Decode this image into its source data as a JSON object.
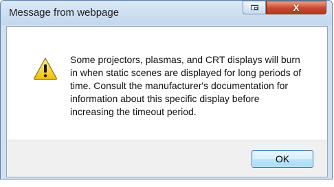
{
  "window": {
    "title": "Message from webpage",
    "controls": {
      "restore_icon": "restore-icon",
      "close_icon": "close-icon",
      "close_glyph": "X"
    }
  },
  "dialog": {
    "icon": "warning-icon",
    "message": "Some projectors, plasmas, and CRT displays will burn in when static scenes are displayed for long periods of time. Consult the manufacturer's documentation for information about this specific display before increasing the timeout period."
  },
  "buttons": {
    "ok_label": "OK"
  },
  "colors": {
    "frame": "#cfe0f1",
    "close_button": "#c54a2f",
    "warning_yellow": "#f5c400"
  }
}
